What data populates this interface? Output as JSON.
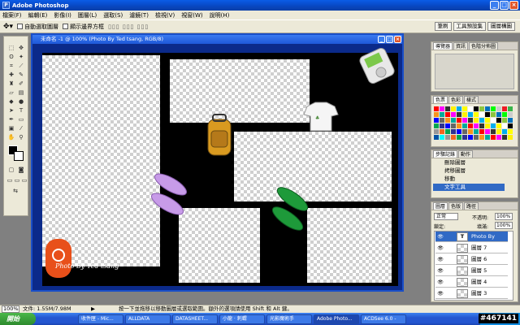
{
  "app": {
    "title": "Adobe Photoshop"
  },
  "menu": [
    "檔案(F)",
    "編輯(E)",
    "影像(I)",
    "圖層(L)",
    "選取(S)",
    "濾鏡(T)",
    "檢視(V)",
    "視窗(W)",
    "說明(H)"
  ],
  "options": {
    "auto_select": "自動選取圖層",
    "show_bounds": "顯示邊界方框",
    "tabs": [
      "筆刷",
      "工具預設集",
      "圖層構圖"
    ]
  },
  "document": {
    "title": "未命名 -1 @ 100% (Photo By Ted tsang, RGB/8)",
    "signature": "Photo By Ted tsang"
  },
  "navigator": {
    "tabs": [
      "導覽器",
      "資訊",
      "色階分佈圖"
    ]
  },
  "color": {
    "tabs": [
      "色票",
      "色彩",
      "樣式"
    ],
    "swatch_colors": [
      "#ff0000",
      "#ffff00",
      "#00ff00",
      "#00ffff",
      "#0000ff",
      "#ff00ff",
      "#ffffff",
      "#cccccc",
      "#999999",
      "#666666",
      "#333333",
      "#000000",
      "#ed1c24",
      "#f26522",
      "#f7941d",
      "#fff200",
      "#8dc63f",
      "#39b54a",
      "#00a651",
      "#00a99d",
      "#00aeef",
      "#0072bc",
      "#0054a6",
      "#2e3192"
    ]
  },
  "history": {
    "tabs": [
      "步驟記錄",
      "動作"
    ],
    "items": [
      "刪除圖層",
      "拷移圖層",
      "移動",
      "文字工具"
    ]
  },
  "layers": {
    "tabs": [
      "圖層",
      "色版",
      "路徑"
    ],
    "blend_mode": "正常",
    "opacity_label": "不透明:",
    "opacity": "100%",
    "lock_label": "鎖定:",
    "fill_label": "填滿:",
    "fill": "100%",
    "items": [
      {
        "name": "Photo By Ted...",
        "type": "T",
        "selected": true
      },
      {
        "name": "圖層 7"
      },
      {
        "name": "圖層 6"
      },
      {
        "name": "圖層 5"
      },
      {
        "name": "圖層 4"
      },
      {
        "name": "圖層 3"
      }
    ]
  },
  "status": {
    "zoom": "100%",
    "doc_size": "文件: 1.55M/7.98M",
    "hint": "按一下並拖移以移動圖層或選取範圍。額外的選項請使用 Shift 和 Alt 鍵。"
  },
  "taskbar": {
    "start": "開始",
    "tasks": [
      "收件匣 - Mic...",
      "ALLDATA",
      "DATASHEET...",
      "小龍 · 刺蝟",
      "光影魔術手",
      "Adobe Photo...",
      "ACDSee 6.0 -"
    ],
    "watermark": "#467141"
  }
}
